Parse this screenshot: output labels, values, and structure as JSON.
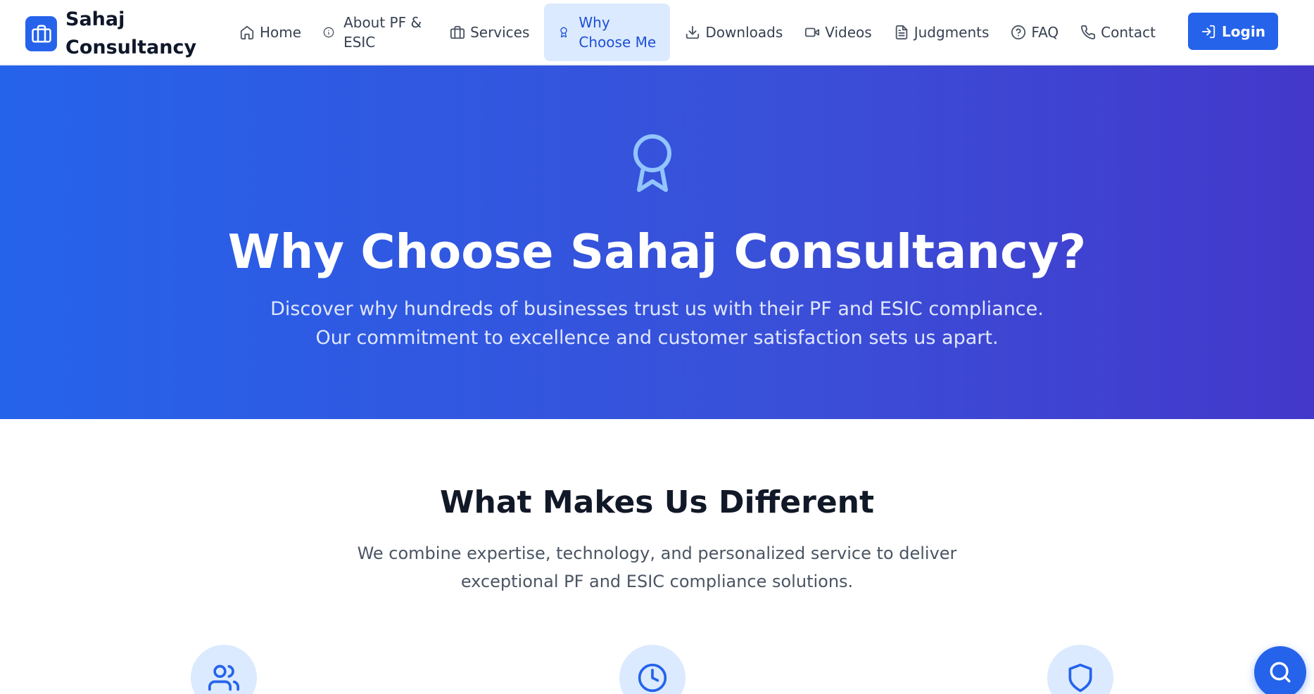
{
  "brand": {
    "name": "Sahaj Consultancy",
    "icon": "briefcase-icon"
  },
  "nav": {
    "items": [
      {
        "label": "Home",
        "icon": "home-icon"
      },
      {
        "label": "About PF & ESIC",
        "icon": "info-icon"
      },
      {
        "label": "Services",
        "icon": "briefcase-icon"
      },
      {
        "label": "Why Choose Me",
        "icon": "award-icon",
        "active": true
      },
      {
        "label": "Downloads",
        "icon": "download-icon"
      },
      {
        "label": "Videos",
        "icon": "video-icon"
      },
      {
        "label": "Judgments",
        "icon": "document-icon"
      },
      {
        "label": "FAQ",
        "icon": "help-circle-icon"
      },
      {
        "label": "Contact",
        "icon": "phone-icon"
      }
    ],
    "login_label": "Login"
  },
  "hero": {
    "icon": "award-icon",
    "title": "Why Choose Sahaj Consultancy?",
    "subtitle": "Discover why hundreds of businesses trust us with their PF and ESIC compliance. Our commitment to excellence and customer satisfaction sets us apart."
  },
  "section": {
    "title": "What Makes Us Different",
    "subtitle": "We combine expertise, technology, and personalized service to deliver exceptional PF and ESIC compliance solutions.",
    "feature_icons": [
      "users-icon",
      "clock-icon",
      "shield-icon"
    ]
  },
  "colors": {
    "primary": "#2563eb",
    "hero_gradient_start": "#2563eb",
    "hero_gradient_end": "#4338ca",
    "active_nav_bg": "#dbeafe",
    "icon_circle_bg": "#dbeafe"
  },
  "floating_button": {
    "icon": "search-icon"
  }
}
